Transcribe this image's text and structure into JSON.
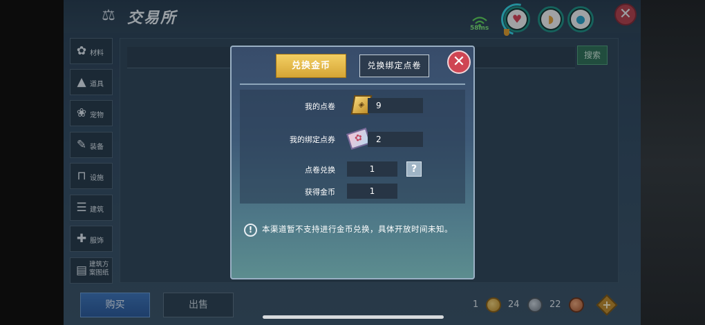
{
  "header": {
    "title": "交易所",
    "title_icon": "scale-icon",
    "ping": "58ms"
  },
  "status_icons": [
    "heart-icon",
    "stomach-icon",
    "water-drop-icon"
  ],
  "sidebar": {
    "items": [
      {
        "label": "材料",
        "icon": "material-icon"
      },
      {
        "label": "道具",
        "icon": "tool-icon"
      },
      {
        "label": "宠物",
        "icon": "paw-icon"
      },
      {
        "label": "装备",
        "icon": "equipment-icon"
      },
      {
        "label": "设施",
        "icon": "facility-icon"
      },
      {
        "label": "建筑",
        "icon": "building-icon"
      },
      {
        "label": "服饰",
        "icon": "clothing-icon"
      },
      {
        "label": "建筑方案图纸",
        "icon": "blueprint-icon"
      }
    ]
  },
  "search": {
    "button_label": "搜索"
  },
  "bottom": {
    "buy_label": "购买",
    "sell_label": "出售",
    "currencies": [
      {
        "amount": "1",
        "icon": "gold-coin-icon"
      },
      {
        "amount": "24",
        "icon": "silver-coin-icon"
      },
      {
        "amount": "22",
        "icon": "copper-coin-icon"
      }
    ]
  },
  "modal": {
    "tabs": {
      "active": "兑换金币",
      "inactive": "兑换绑定点卷"
    },
    "rows": {
      "my_points": {
        "label": "我的点卷",
        "value": "9"
      },
      "my_bound_points": {
        "label": "我的绑定点券",
        "value": "2"
      },
      "exchange": {
        "label": "点卷兑换",
        "value": "1"
      },
      "gain": {
        "label": "获得金币",
        "value": "1"
      }
    },
    "notice": "本渠道暂不支持进行金币兑换，具体开放时间未知。"
  },
  "colors": {
    "accent_gold": "#e3b84a",
    "close_red": "#cf4553",
    "search_green": "#2f6f55",
    "buy_blue": "#3d73b8"
  }
}
